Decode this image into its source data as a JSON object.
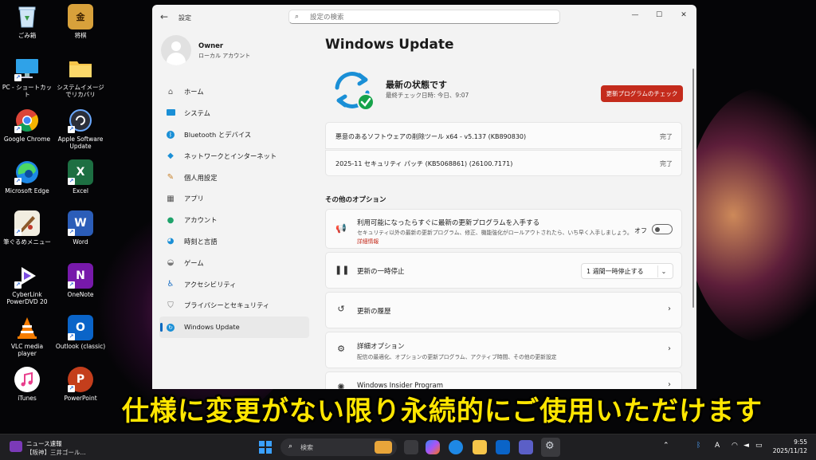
{
  "desktop": {
    "icons": [
      {
        "label": "ごみ箱",
        "icon": "recycle-bin-icon"
      },
      {
        "label": "将棋",
        "icon": "shogi-icon"
      },
      {
        "label": "PC - ショートカット",
        "icon": "pc-monitor-icon"
      },
      {
        "label": "システムイメージでリカバリ",
        "icon": "folder-icon"
      },
      {
        "label": "Google Chrome",
        "icon": "chrome-icon"
      },
      {
        "label": "Apple Software Update",
        "icon": "apple-update-icon"
      },
      {
        "label": "Microsoft Edge",
        "icon": "edge-icon"
      },
      {
        "label": "Excel",
        "icon": "excel-icon"
      },
      {
        "label": "筆ぐるめメニュー",
        "icon": "fudegurume-icon"
      },
      {
        "label": "Word",
        "icon": "word-icon"
      },
      {
        "label": "CyberLink PowerDVD 20",
        "icon": "powerdvd-icon"
      },
      {
        "label": "OneNote",
        "icon": "onenote-icon"
      },
      {
        "label": "VLC media player",
        "icon": "vlc-icon"
      },
      {
        "label": "Outlook (classic)",
        "icon": "outlook-icon"
      },
      {
        "label": "iTunes",
        "icon": "itunes-icon"
      },
      {
        "label": "PowerPoint",
        "icon": "powerpoint-icon"
      }
    ]
  },
  "window": {
    "app_title": "設定",
    "search_placeholder": "設定の検索",
    "controls": {
      "minimize": "—",
      "maximize": "☐",
      "close": "✕"
    }
  },
  "profile": {
    "name": "Owner",
    "subtitle": "ローカル アカウント"
  },
  "nav": {
    "items": [
      {
        "label": "ホーム",
        "icon": "home-icon"
      },
      {
        "label": "システム",
        "icon": "system-monitor-icon"
      },
      {
        "label": "Bluetooth とデバイス",
        "icon": "bluetooth-icon"
      },
      {
        "label": "ネットワークとインターネット",
        "icon": "wifi-icon"
      },
      {
        "label": "個人用設定",
        "icon": "brush-icon"
      },
      {
        "label": "アプリ",
        "icon": "apps-icon"
      },
      {
        "label": "アカウント",
        "icon": "account-icon"
      },
      {
        "label": "時刻と言語",
        "icon": "globe-clock-icon"
      },
      {
        "label": "ゲーム",
        "icon": "gamepad-icon"
      },
      {
        "label": "アクセシビリティ",
        "icon": "accessibility-icon"
      },
      {
        "label": "プライバシーとセキュリティ",
        "icon": "shield-icon"
      },
      {
        "label": "Windows Update",
        "icon": "windows-update-icon"
      }
    ],
    "active_index": 11
  },
  "main": {
    "page_title": "Windows Update",
    "status_title": "最新の状態です",
    "status_sub": "最終チェック日時: 今日、9:07",
    "check_button": "更新プログラムのチェック",
    "updates": [
      {
        "title": "悪意のあるソフトウェアの削除ツール x64 - v5.137 (KB890830)",
        "status": "完了"
      },
      {
        "title": "2025-11 セキュリティ パッチ (KB5068861) (26100.7171)",
        "status": "完了"
      }
    ],
    "other_options_title": "その他のオプション",
    "options": {
      "latest": {
        "title": "利用可能になったらすぐに最新の更新プログラムを入手する",
        "desc": "セキュリティ以外の最新の更新プログラム、修正、機能強化がロールアウトされたら、いち早く入手しましょう。",
        "link": "詳細情報",
        "toggle_label": "オフ",
        "toggle_on": false
      },
      "pause": {
        "title": "更新の一時停止",
        "dropdown_value": "1 週間一時停止する"
      },
      "history": {
        "title": "更新の履歴"
      },
      "advanced": {
        "title": "詳細オプション",
        "desc": "配信の最適化、オプションの更新プログラム、アクティブ時間、その他の更新設定"
      },
      "insider": {
        "title": "Windows Insider Program"
      }
    }
  },
  "caption": "仕様に変更がない限り永続的にご使用いただけます",
  "taskbar": {
    "news_line1": "ニュース速報",
    "news_line2": "【阪神】三井ゴール...",
    "search_text": "検索",
    "time": "9:55",
    "date": "2025/11/12",
    "ime": "A"
  },
  "colors": {
    "accent_blue": "#0067c0",
    "check_button_red": "#c42b1c",
    "caption_yellow": "#ffe600",
    "update_green": "#16a34a"
  }
}
